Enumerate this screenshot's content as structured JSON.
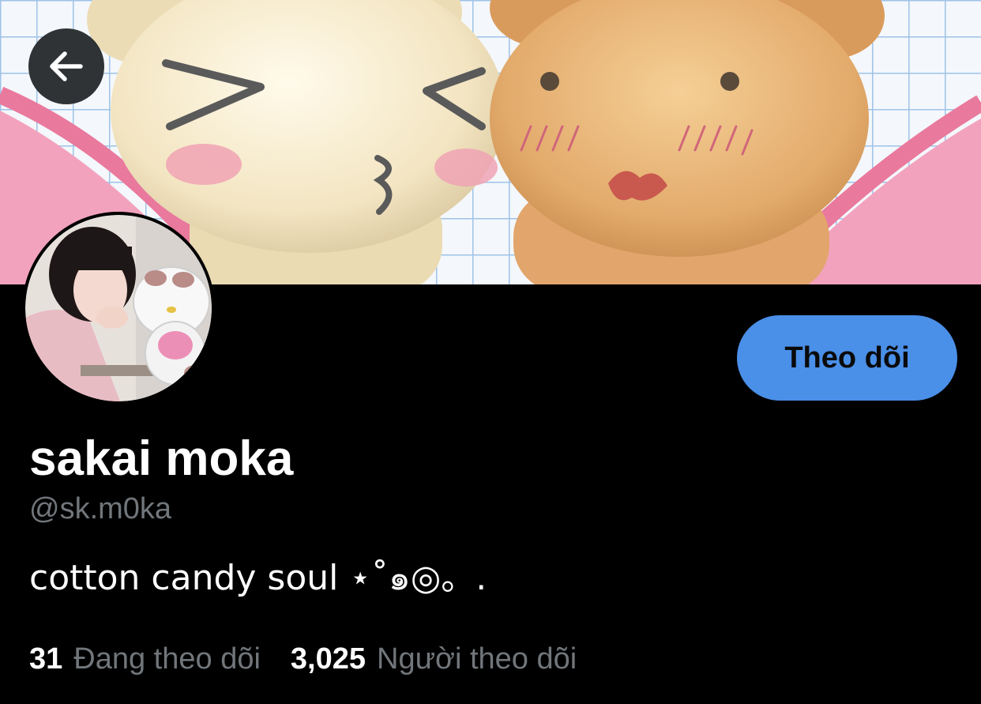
{
  "header": {
    "back_icon": "arrow-left-icon"
  },
  "profile": {
    "display_name": "sakai moka",
    "handle": "@sk.m0ka",
    "bio": "cotton candy soul ⋆˚๑◎。.",
    "follow_label": "Theo dõi"
  },
  "stats": {
    "following_count": "31",
    "following_label": "Đang theo dõi",
    "followers_count": "3,025",
    "followers_label": "Người theo dõi"
  },
  "colors": {
    "accent": "#4a8fe8",
    "muted_text": "#71767b",
    "background": "#000000"
  }
}
